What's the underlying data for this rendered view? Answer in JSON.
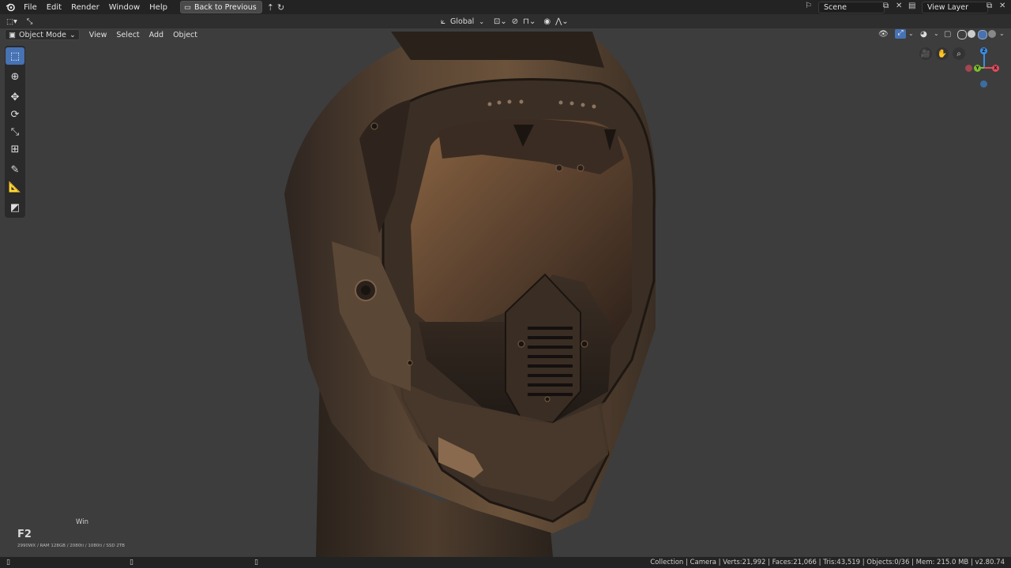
{
  "topbar": {
    "menus": [
      "File",
      "Edit",
      "Render",
      "Window",
      "Help"
    ],
    "back_button": "Back to Previous",
    "scene_label": "Scene",
    "viewlayer_label": "View Layer"
  },
  "header": {
    "orientation": "Global",
    "mode": "Object Mode",
    "menus": [
      "View",
      "Select",
      "Add",
      "Object"
    ]
  },
  "toolbar": {
    "tools": [
      "select-box-icon",
      "cursor-icon",
      "move-icon",
      "rotate-icon",
      "scale-icon",
      "transform-icon",
      "annotate-icon",
      "measure-icon",
      "add-cube-icon"
    ]
  },
  "overlay": {
    "key_display": "F2",
    "key_context": "Win",
    "specs": "2990WX / RAM 128GB / 2080ti / 1080ti / SSD 2TB"
  },
  "statusbar": {
    "text": "Collection | Camera | Verts:21,992 | Faces:21,066 | Tris:43,519 | Objects:0/36 | Mem: 215.0 MB | v2.80.74"
  },
  "colors": {
    "accent": "#4772b3",
    "axis_x": "#e64c5b",
    "axis_y": "#7dbd2e",
    "axis_z": "#3a8ee6",
    "viewport_bg": "#3d3d3d"
  }
}
